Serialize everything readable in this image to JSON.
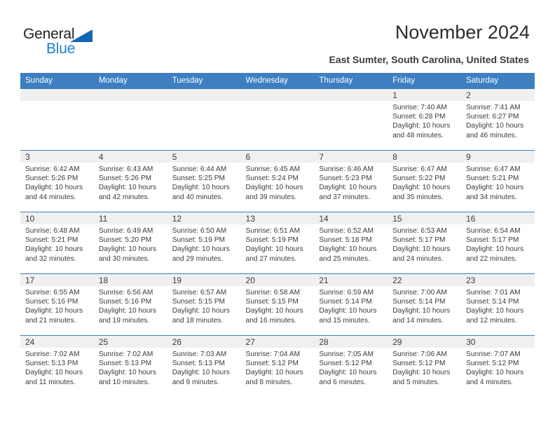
{
  "logo": {
    "word_dark": "General",
    "word_blue": "Blue",
    "triangle_color": "#1267b2",
    "blue_color": "#1b7fd4"
  },
  "header": {
    "title": "November 2024",
    "subtitle": "East Sumter, South Carolina, United States"
  },
  "theme": {
    "header_row_bg": "#3d7fc1",
    "header_row_text": "#ffffff",
    "daybar_bg": "#f0f0f0",
    "row_border": "#3d7fc1",
    "body_text": "#3b3b3b"
  },
  "weekdays": [
    "Sunday",
    "Monday",
    "Tuesday",
    "Wednesday",
    "Thursday",
    "Friday",
    "Saturday"
  ],
  "weeks": [
    [
      {
        "day": "",
        "blank": true
      },
      {
        "day": "",
        "blank": true
      },
      {
        "day": "",
        "blank": true
      },
      {
        "day": "",
        "blank": true
      },
      {
        "day": "",
        "blank": true
      },
      {
        "day": "1",
        "sunrise": "Sunrise: 7:40 AM",
        "sunset": "Sunset: 6:28 PM",
        "daylight1": "Daylight: 10 hours",
        "daylight2": "and 48 minutes."
      },
      {
        "day": "2",
        "sunrise": "Sunrise: 7:41 AM",
        "sunset": "Sunset: 6:27 PM",
        "daylight1": "Daylight: 10 hours",
        "daylight2": "and 46 minutes."
      }
    ],
    [
      {
        "day": "3",
        "sunrise": "Sunrise: 6:42 AM",
        "sunset": "Sunset: 5:26 PM",
        "daylight1": "Daylight: 10 hours",
        "daylight2": "and 44 minutes."
      },
      {
        "day": "4",
        "sunrise": "Sunrise: 6:43 AM",
        "sunset": "Sunset: 5:26 PM",
        "daylight1": "Daylight: 10 hours",
        "daylight2": "and 42 minutes."
      },
      {
        "day": "5",
        "sunrise": "Sunrise: 6:44 AM",
        "sunset": "Sunset: 5:25 PM",
        "daylight1": "Daylight: 10 hours",
        "daylight2": "and 40 minutes."
      },
      {
        "day": "6",
        "sunrise": "Sunrise: 6:45 AM",
        "sunset": "Sunset: 5:24 PM",
        "daylight1": "Daylight: 10 hours",
        "daylight2": "and 39 minutes."
      },
      {
        "day": "7",
        "sunrise": "Sunrise: 6:46 AM",
        "sunset": "Sunset: 5:23 PM",
        "daylight1": "Daylight: 10 hours",
        "daylight2": "and 37 minutes."
      },
      {
        "day": "8",
        "sunrise": "Sunrise: 6:47 AM",
        "sunset": "Sunset: 5:22 PM",
        "daylight1": "Daylight: 10 hours",
        "daylight2": "and 35 minutes."
      },
      {
        "day": "9",
        "sunrise": "Sunrise: 6:47 AM",
        "sunset": "Sunset: 5:21 PM",
        "daylight1": "Daylight: 10 hours",
        "daylight2": "and 34 minutes."
      }
    ],
    [
      {
        "day": "10",
        "sunrise": "Sunrise: 6:48 AM",
        "sunset": "Sunset: 5:21 PM",
        "daylight1": "Daylight: 10 hours",
        "daylight2": "and 32 minutes."
      },
      {
        "day": "11",
        "sunrise": "Sunrise: 6:49 AM",
        "sunset": "Sunset: 5:20 PM",
        "daylight1": "Daylight: 10 hours",
        "daylight2": "and 30 minutes."
      },
      {
        "day": "12",
        "sunrise": "Sunrise: 6:50 AM",
        "sunset": "Sunset: 5:19 PM",
        "daylight1": "Daylight: 10 hours",
        "daylight2": "and 29 minutes."
      },
      {
        "day": "13",
        "sunrise": "Sunrise: 6:51 AM",
        "sunset": "Sunset: 5:19 PM",
        "daylight1": "Daylight: 10 hours",
        "daylight2": "and 27 minutes."
      },
      {
        "day": "14",
        "sunrise": "Sunrise: 6:52 AM",
        "sunset": "Sunset: 5:18 PM",
        "daylight1": "Daylight: 10 hours",
        "daylight2": "and 25 minutes."
      },
      {
        "day": "15",
        "sunrise": "Sunrise: 6:53 AM",
        "sunset": "Sunset: 5:17 PM",
        "daylight1": "Daylight: 10 hours",
        "daylight2": "and 24 minutes."
      },
      {
        "day": "16",
        "sunrise": "Sunrise: 6:54 AM",
        "sunset": "Sunset: 5:17 PM",
        "daylight1": "Daylight: 10 hours",
        "daylight2": "and 22 minutes."
      }
    ],
    [
      {
        "day": "17",
        "sunrise": "Sunrise: 6:55 AM",
        "sunset": "Sunset: 5:16 PM",
        "daylight1": "Daylight: 10 hours",
        "daylight2": "and 21 minutes."
      },
      {
        "day": "18",
        "sunrise": "Sunrise: 6:56 AM",
        "sunset": "Sunset: 5:16 PM",
        "daylight1": "Daylight: 10 hours",
        "daylight2": "and 19 minutes."
      },
      {
        "day": "19",
        "sunrise": "Sunrise: 6:57 AM",
        "sunset": "Sunset: 5:15 PM",
        "daylight1": "Daylight: 10 hours",
        "daylight2": "and 18 minutes."
      },
      {
        "day": "20",
        "sunrise": "Sunrise: 6:58 AM",
        "sunset": "Sunset: 5:15 PM",
        "daylight1": "Daylight: 10 hours",
        "daylight2": "and 16 minutes."
      },
      {
        "day": "21",
        "sunrise": "Sunrise: 6:59 AM",
        "sunset": "Sunset: 5:14 PM",
        "daylight1": "Daylight: 10 hours",
        "daylight2": "and 15 minutes."
      },
      {
        "day": "22",
        "sunrise": "Sunrise: 7:00 AM",
        "sunset": "Sunset: 5:14 PM",
        "daylight1": "Daylight: 10 hours",
        "daylight2": "and 14 minutes."
      },
      {
        "day": "23",
        "sunrise": "Sunrise: 7:01 AM",
        "sunset": "Sunset: 5:14 PM",
        "daylight1": "Daylight: 10 hours",
        "daylight2": "and 12 minutes."
      }
    ],
    [
      {
        "day": "24",
        "sunrise": "Sunrise: 7:02 AM",
        "sunset": "Sunset: 5:13 PM",
        "daylight1": "Daylight: 10 hours",
        "daylight2": "and 11 minutes."
      },
      {
        "day": "25",
        "sunrise": "Sunrise: 7:02 AM",
        "sunset": "Sunset: 5:13 PM",
        "daylight1": "Daylight: 10 hours",
        "daylight2": "and 10 minutes."
      },
      {
        "day": "26",
        "sunrise": "Sunrise: 7:03 AM",
        "sunset": "Sunset: 5:13 PM",
        "daylight1": "Daylight: 10 hours",
        "daylight2": "and 9 minutes."
      },
      {
        "day": "27",
        "sunrise": "Sunrise: 7:04 AM",
        "sunset": "Sunset: 5:12 PM",
        "daylight1": "Daylight: 10 hours",
        "daylight2": "and 8 minutes."
      },
      {
        "day": "28",
        "sunrise": "Sunrise: 7:05 AM",
        "sunset": "Sunset: 5:12 PM",
        "daylight1": "Daylight: 10 hours",
        "daylight2": "and 6 minutes."
      },
      {
        "day": "29",
        "sunrise": "Sunrise: 7:06 AM",
        "sunset": "Sunset: 5:12 PM",
        "daylight1": "Daylight: 10 hours",
        "daylight2": "and 5 minutes."
      },
      {
        "day": "30",
        "sunrise": "Sunrise: 7:07 AM",
        "sunset": "Sunset: 5:12 PM",
        "daylight1": "Daylight: 10 hours",
        "daylight2": "and 4 minutes."
      }
    ]
  ]
}
